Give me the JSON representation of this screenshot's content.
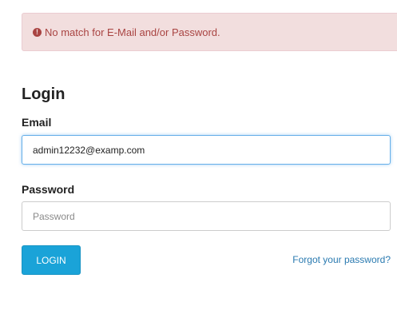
{
  "alert": {
    "icon": "exclamation-circle-icon",
    "message": "No match for E-Mail and/or Password.",
    "color": "#a94442",
    "background": "#f2dede"
  },
  "form": {
    "title": "Login",
    "email_label": "Email",
    "email_value": "admin12232@examp.com",
    "password_label": "Password",
    "password_placeholder": "Password",
    "login_button": "LOGIN",
    "forgot_link": "Forgot your password?"
  },
  "colors": {
    "primary": "#1aa3d8",
    "link": "#2a7ab0",
    "focus_border": "#66afe9"
  }
}
